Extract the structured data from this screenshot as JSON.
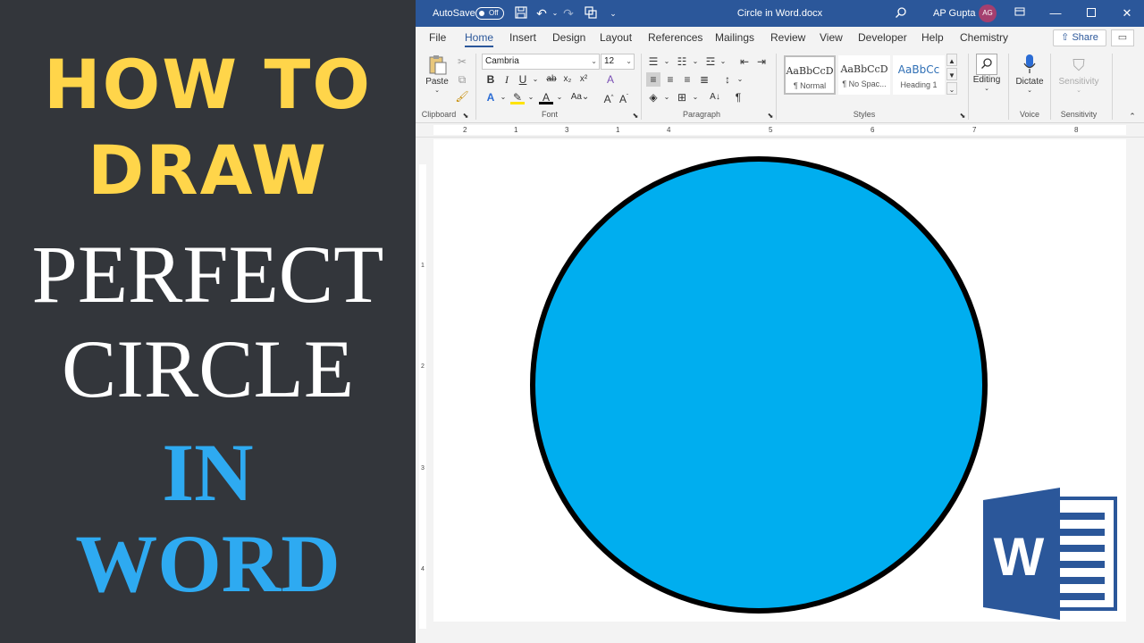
{
  "thumbnail": {
    "line1": "HOW TO",
    "line2": "DRAW",
    "line3": "PERFECT",
    "line4": "CIRCLE",
    "line5": "IN",
    "line6": "WORD",
    "colors": {
      "background": "#33363b",
      "yellow": "#ffd54a",
      "white": "#ffffff",
      "blue": "#2eaaf1"
    }
  },
  "window": {
    "autosave_label": "AutoSave",
    "autosave_state": "Off",
    "title": "Circle in Word.docx",
    "user_name": "AP Gupta",
    "user_initials": "AG",
    "accent": "#2b579a"
  },
  "tabs": [
    "File",
    "Home",
    "Insert",
    "Design",
    "Layout",
    "References",
    "Mailings",
    "Review",
    "View",
    "Developer",
    "Help",
    "Chemistry"
  ],
  "active_tab": "Home",
  "share_label": "Share",
  "ribbon": {
    "clipboard": {
      "paste_label": "Paste",
      "group_label": "Clipboard"
    },
    "font": {
      "name": "Cambria",
      "size": "12",
      "group_label": "Font"
    },
    "paragraph": {
      "group_label": "Paragraph"
    },
    "styles": {
      "group_label": "Styles",
      "items": [
        {
          "sample": "AaBbCcD",
          "name": "¶ Normal"
        },
        {
          "sample": "AaBbCcD",
          "name": "¶ No Spac..."
        },
        {
          "sample": "AaBbCc",
          "name": "Heading 1"
        }
      ]
    },
    "editing_label": "Editing",
    "dictate_label": "Dictate",
    "voice_group_label": "Voice",
    "sensitivity_label": "Sensitivity",
    "sensitivity_group_label": "Sensitivity"
  },
  "ruler_numbers": [
    "2",
    "1",
    "1",
    "2",
    "3",
    "4",
    "5",
    "6",
    "7",
    "8"
  ],
  "vertical_ruler_numbers": [
    "1",
    "2",
    "3",
    "4"
  ],
  "shape": {
    "type": "circle",
    "fill": "#00aeef",
    "outline": "#000000"
  },
  "logo": {
    "letter": "W",
    "color": "#2b579a"
  }
}
